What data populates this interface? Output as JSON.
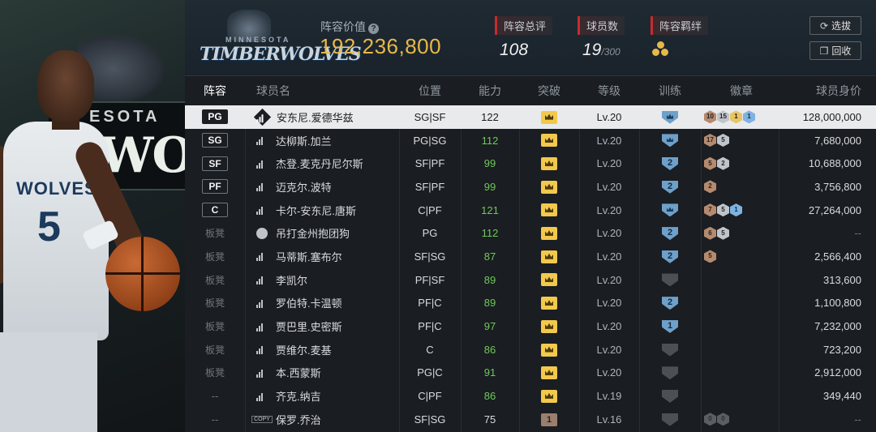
{
  "header": {
    "team_line1": "MINNESOTA",
    "team_line2": "TIMBERWOLVES",
    "lineup_value_label": "阵容价值",
    "lineup_value": "192,236,800",
    "stats": [
      {
        "label": "阵容总评",
        "value": "108"
      },
      {
        "label": "球员数",
        "value": "19",
        "max": "/300"
      },
      {
        "label": "阵容羁绊",
        "value": ""
      }
    ],
    "buttons": [
      {
        "label": "选拔",
        "icon": "refresh-icon"
      },
      {
        "label": "回收",
        "icon": "copy-icon"
      }
    ]
  },
  "art": {
    "banner_line1": "ESOTA",
    "banner_line2": "WOLV",
    "jersey_text": "WOLVES",
    "jersey_number": "5"
  },
  "columns": [
    "阵容",
    "球员名",
    "位置",
    "能力",
    "突破",
    "等级",
    "训练",
    "徽章",
    "球员身价"
  ],
  "rows": [
    {
      "slot": "PG",
      "slot_type": "starter",
      "name": "安东尼.爱德华兹",
      "pos": "SG|SF",
      "ability": "122",
      "breakthrough": "crown",
      "level": "Lv.20",
      "training": "crown",
      "badges": [
        [
          "bronze",
          "10"
        ],
        [
          "silver",
          "15"
        ],
        [
          "gold",
          "1"
        ],
        [
          "blue",
          "1"
        ]
      ],
      "value": "128,000,000",
      "selected": true,
      "icon": "signal-icon"
    },
    {
      "slot": "SG",
      "slot_type": "starter",
      "name": "达柳斯.加兰",
      "pos": "PG|SG",
      "ability": "112",
      "breakthrough": "crown",
      "level": "Lv.20",
      "training": "crown",
      "badges": [
        [
          "bronze",
          "17"
        ],
        [
          "silver",
          "5"
        ]
      ],
      "value": "7,680,000",
      "icon": "signal-icon"
    },
    {
      "slot": "SF",
      "slot_type": "starter",
      "name": "杰登.麦克丹尼尔斯",
      "pos": "SF|PF",
      "ability": "99",
      "breakthrough": "crown",
      "level": "Lv.20",
      "training": "2",
      "badges": [
        [
          "bronze",
          "5"
        ],
        [
          "silver",
          "2"
        ]
      ],
      "value": "10,688,000",
      "icon": "signal-icon"
    },
    {
      "slot": "PF",
      "slot_type": "starter",
      "name": "迈克尔.波特",
      "pos": "SF|PF",
      "ability": "99",
      "breakthrough": "crown",
      "level": "Lv.20",
      "training": "2",
      "badges": [
        [
          "bronze",
          "2"
        ]
      ],
      "value": "3,756,800",
      "icon": "signal-icon"
    },
    {
      "slot": "C",
      "slot_type": "starter",
      "name": "卡尔-安东尼.唐斯",
      "pos": "C|PF",
      "ability": "121",
      "breakthrough": "crown",
      "level": "Lv.20",
      "training": "crown",
      "badges": [
        [
          "bronze",
          "7"
        ],
        [
          "silver",
          "5"
        ],
        [
          "blue",
          "1"
        ]
      ],
      "value": "27,264,000",
      "icon": "signal-icon"
    },
    {
      "slot": "板凳",
      "slot_type": "bench",
      "name": "吊打金州抱团狗",
      "pos": "PG",
      "ability": "112",
      "breakthrough": "crown",
      "level": "Lv.20",
      "training": "2",
      "badges": [
        [
          "bronze",
          "6"
        ],
        [
          "silver",
          "5"
        ]
      ],
      "value": "--",
      "icon": "person-icon"
    },
    {
      "slot": "板凳",
      "slot_type": "bench",
      "name": "马蒂斯.塞布尔",
      "pos": "SF|SG",
      "ability": "87",
      "breakthrough": "crown",
      "level": "Lv.20",
      "training": "2",
      "badges": [
        [
          "bronze",
          "5"
        ]
      ],
      "value": "2,566,400",
      "icon": "signal-icon"
    },
    {
      "slot": "板凳",
      "slot_type": "bench",
      "name": "李凯尔",
      "pos": "PF|SF",
      "ability": "89",
      "breakthrough": "crown",
      "level": "Lv.20",
      "training": "grey",
      "badges": [],
      "value": "313,600",
      "icon": "signal-icon"
    },
    {
      "slot": "板凳",
      "slot_type": "bench",
      "name": "罗伯特.卡温顿",
      "pos": "PF|C",
      "ability": "89",
      "breakthrough": "crown",
      "level": "Lv.20",
      "training": "2",
      "badges": [],
      "value": "1,100,800",
      "icon": "signal-icon"
    },
    {
      "slot": "板凳",
      "slot_type": "bench",
      "name": "贾巴里.史密斯",
      "pos": "PF|C",
      "ability": "97",
      "breakthrough": "crown",
      "level": "Lv.20",
      "training": "1",
      "badges": [],
      "value": "7,232,000",
      "icon": "signal-icon"
    },
    {
      "slot": "板凳",
      "slot_type": "bench",
      "name": "贾维尔.麦基",
      "pos": "C",
      "ability": "86",
      "breakthrough": "crown",
      "level": "Lv.20",
      "training": "grey",
      "badges": [],
      "value": "723,200",
      "icon": "signal-icon"
    },
    {
      "slot": "板凳",
      "slot_type": "bench",
      "name": "本.西蒙斯",
      "pos": "PG|C",
      "ability": "91",
      "breakthrough": "crown",
      "level": "Lv.20",
      "training": "grey",
      "badges": [],
      "value": "2,912,000",
      "icon": "signal-icon"
    },
    {
      "slot": "--",
      "slot_type": "none",
      "name": "齐克.纳吉",
      "pos": "C|PF",
      "ability": "86",
      "breakthrough": "crown",
      "level": "Lv.19",
      "training": "grey",
      "badges": [],
      "value": "349,440",
      "icon": "signal-icon"
    },
    {
      "slot": "--",
      "slot_type": "none",
      "name": "保罗.乔治",
      "pos": "SF|SG",
      "ability": "75",
      "breakthrough": "1",
      "level": "Lv.16",
      "training": "grey",
      "badges": [
        [
          "grey",
          "0"
        ],
        [
          "grey",
          "0"
        ]
      ],
      "value": "--",
      "icon": "copy-label",
      "icon_text": "COPY"
    }
  ],
  "colors": {
    "accent_gold": "#e7b84a",
    "ability_green": "#6ec95a",
    "stat_red": "#c72c2c",
    "training_blue": "#6ea0c9"
  }
}
